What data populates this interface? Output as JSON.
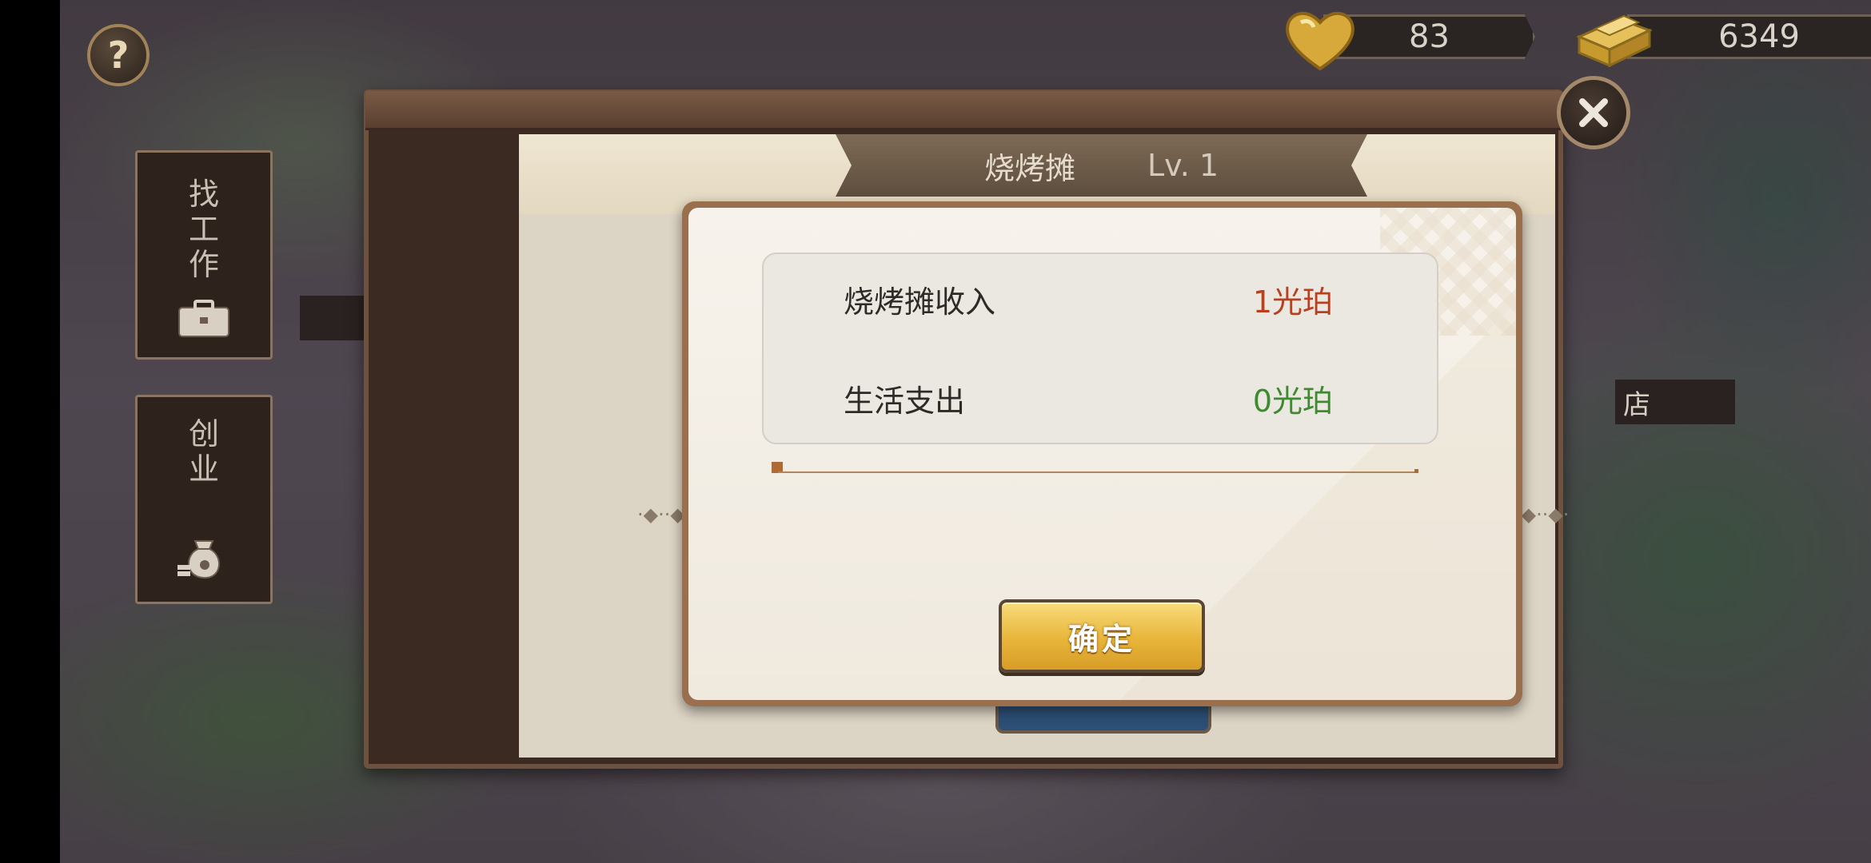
{
  "hud": {
    "help_label": "?",
    "hearts": "83",
    "gold": "6349"
  },
  "sidebar": {
    "job_tab": [
      "找",
      "工",
      "作"
    ],
    "business_tab": [
      "创",
      "",
      "业"
    ]
  },
  "header": {
    "title": "烧烤摊",
    "level": "Lv.   1"
  },
  "background": {
    "right_label": "店"
  },
  "dialog": {
    "rows": [
      {
        "label": "烧烤摊收入",
        "value": "1光珀",
        "color": "#b8401f"
      },
      {
        "label": "生活支出",
        "value": "0光珀",
        "color": "#3d8a2f"
      }
    ],
    "confirm_label": "确定"
  },
  "icons": {
    "close": "close-icon",
    "heart": "heart-icon",
    "gold": "gold-icon",
    "briefcase": "briefcase-icon",
    "money_bag": "money-bag-icon"
  },
  "colors": {
    "income_value": "#b8401f",
    "expense_value": "#3d8a2f",
    "confirm_button": "#e8b53a"
  }
}
